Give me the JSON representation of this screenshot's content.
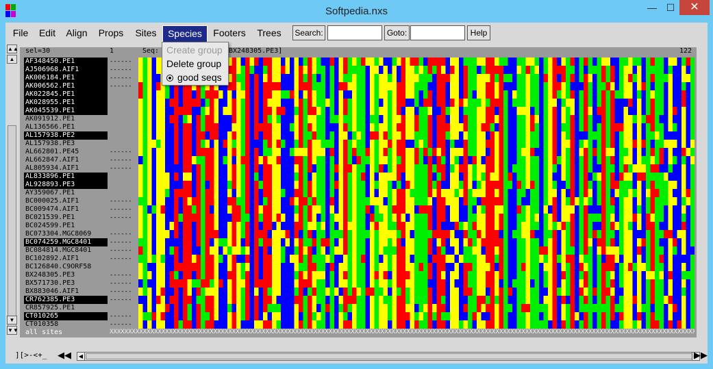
{
  "window": {
    "title": "Softpedia.nxs",
    "minimize": "—",
    "maximize": "☐",
    "close": "✕"
  },
  "menubar": {
    "file": "File",
    "edit": "Edit",
    "align": "Align",
    "props": "Props",
    "sites": "Sites",
    "species": "Species",
    "footers": "Footers",
    "trees": "Trees",
    "search_button": "Search:",
    "search_value": "",
    "goto_button": "Goto:",
    "goto_value": "",
    "help_button": "Help"
  },
  "species_menu": {
    "create_group": "Create group",
    "delete_group": "Delete group",
    "good_seqs": "good seqs"
  },
  "header": {
    "selection": "sel=30",
    "start_col": "1",
    "seq_label": "Seq:",
    "seq_name_tail": "BX248305.PE3]",
    "end_col": "122"
  },
  "sequences": [
    {
      "name": "AF348450.PE1",
      "selected": true,
      "gaps": "------"
    },
    {
      "name": "AJ506968.AIF1",
      "selected": true,
      "gaps": "------"
    },
    {
      "name": "AK006184.PE1",
      "selected": true,
      "gaps": "------"
    },
    {
      "name": "AK006562.PE1",
      "selected": true,
      "gaps": "------"
    },
    {
      "name": "AK022845.PE1",
      "selected": true,
      "gaps": ""
    },
    {
      "name": "AK028955.PE1",
      "selected": true,
      "gaps": ""
    },
    {
      "name": "AK045539.PE1",
      "selected": true,
      "gaps": ""
    },
    {
      "name": "AK091912.PE1",
      "selected": false,
      "gaps": ""
    },
    {
      "name": "AL136566.PE1",
      "selected": false,
      "gaps": ""
    },
    {
      "name": "AL157938.PE2",
      "selected": true,
      "gaps": ""
    },
    {
      "name": "AL157938.PE3",
      "selected": false,
      "gaps": ""
    },
    {
      "name": "AL662801.PE45",
      "selected": false,
      "gaps": "------"
    },
    {
      "name": "AL662847.AIF1",
      "selected": false,
      "gaps": "------"
    },
    {
      "name": "AL805934.AIF1",
      "selected": false,
      "gaps": "------"
    },
    {
      "name": "AL833896.PE1",
      "selected": true,
      "gaps": ""
    },
    {
      "name": "AL928893.PE3",
      "selected": true,
      "gaps": ""
    },
    {
      "name": "AY359067.PE1",
      "selected": false,
      "gaps": ""
    },
    {
      "name": "BC000025.AIF1",
      "selected": false,
      "gaps": "------"
    },
    {
      "name": "BC009474.AIF1",
      "selected": false,
      "gaps": "------"
    },
    {
      "name": "BC021539.PE1",
      "selected": false,
      "gaps": "------"
    },
    {
      "name": "BC024599.PE1",
      "selected": false,
      "gaps": ""
    },
    {
      "name": "BC073304.MGC8069",
      "selected": false,
      "gaps": "------"
    },
    {
      "name": "BC074259.MGC8401",
      "selected": true,
      "gaps": "------"
    },
    {
      "name": "BC084814.MGC8401",
      "selected": false,
      "gaps": "------"
    },
    {
      "name": "BC102892.AIF1",
      "selected": false,
      "gaps": "------"
    },
    {
      "name": "BC126840.C9ORF58",
      "selected": false,
      "gaps": ""
    },
    {
      "name": "BX248305.PE3",
      "selected": false,
      "gaps": "------"
    },
    {
      "name": "BX571730.PE3",
      "selected": false,
      "gaps": "------"
    },
    {
      "name": "BX883046.AIF1",
      "selected": false,
      "gaps": "------"
    },
    {
      "name": "CR762385.PE3",
      "selected": true,
      "gaps": "------"
    },
    {
      "name": "CR857925.PE1",
      "selected": false,
      "gaps": ""
    },
    {
      "name": "CT010265",
      "selected": true,
      "gaps": "------"
    },
    {
      "name": "CT010358",
      "selected": false,
      "gaps": "------"
    }
  ],
  "all_sites": {
    "label": "all sites",
    "marks": "XXXXXXXXXXXXXXXXXXXXXXXXXXXXXXXXXXXXXXXXXXXXXXXXXXXXXXXXXXXXXXXXXXXXXXXXXXXXXXXXXXXXXXXXXXXXXXXXXXXXXXXXXXXXXXXXXXXXXXXXXXXXXXXXXXXXXXXXXXXXXXXXXXXXXXXXXXXXXXXXXXXXXX"
  },
  "bottom": {
    "scroll_label": "][>-<+_",
    "first_icon": "double-left-arrow-icon",
    "last_icon": "double-right-arrow-icon"
  },
  "colors": {
    "A": "#ff0000",
    "C": "#00ee00",
    "G": "#ffff00",
    "T": "#0000ff",
    "selection": "#1d2a8a",
    "panel": "#9a9a9a",
    "titlebar": "#6ec9f5"
  }
}
